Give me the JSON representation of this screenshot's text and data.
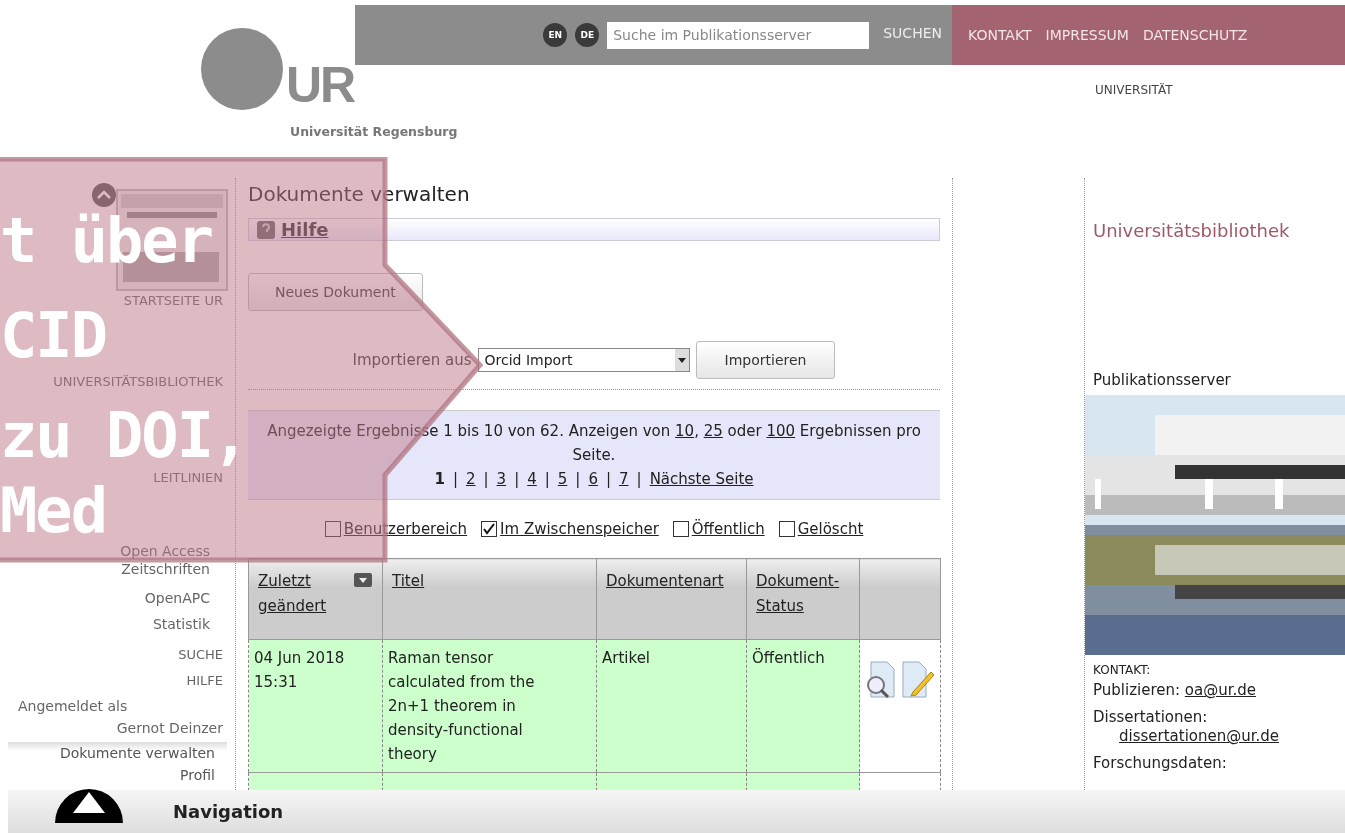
{
  "header": {
    "logo_text": "UR",
    "logo_caption": "Universität Regensburg",
    "languages": [
      {
        "label": "EN",
        "selected": false
      },
      {
        "label": "DE",
        "selected": false
      }
    ],
    "search": {
      "placeholder": "Suche im Publikationsserver"
    },
    "search_button": "SUCHEN",
    "top_links": [
      "KONTAKT",
      "IMPRESSUM",
      "DATENSCHUTZ"
    ],
    "university_label": "UNIVERSITÄT"
  },
  "sidebar": {
    "items": [
      {
        "label": "STARTSEITE UR",
        "kind": "main"
      },
      {
        "label": "UNIVERSITÄTSBIBLIOTHEK",
        "kind": "main"
      },
      {
        "label": "LEITLINIEN",
        "kind": "main"
      },
      {
        "label": "Open Access Zeitschriften",
        "kind": "sub"
      },
      {
        "label": "OpenAPC",
        "kind": "sub"
      },
      {
        "label": "Statistik",
        "kind": "sub"
      },
      {
        "label": "SUCHE",
        "kind": "main"
      },
      {
        "label": "HILFE",
        "kind": "main"
      }
    ],
    "login_label": "Angemeldet als",
    "user_name": "Gernot Deinzer",
    "user_menu": [
      {
        "label": "Dokumente verwalten",
        "selected": true
      },
      {
        "label": "Profil",
        "selected": false
      }
    ]
  },
  "main": {
    "title": "Dokumente verwalten",
    "help": "Hilfe",
    "new_button": "Neues Dokument",
    "import_label": "Importieren aus",
    "import_select": "Orcid Import",
    "import_button": "Importieren",
    "results": [
      {
        "text": "Angezeigte Ergebnisse 1 bis 10 von 62. Anzeigen von ",
        "kind": "text"
      },
      {
        "text": "10",
        "kind": "link"
      },
      {
        "text": ", ",
        "kind": "text"
      },
      {
        "text": "25",
        "kind": "link"
      },
      {
        "text": " oder ",
        "kind": "text"
      },
      {
        "text": "100",
        "kind": "link"
      },
      {
        "text": " Ergebnissen pro Seite.",
        "kind": "text"
      }
    ],
    "pages": [
      {
        "label": "1",
        "selected": true
      },
      {
        "label": "2",
        "selected": false
      },
      {
        "label": "3",
        "selected": false
      },
      {
        "label": "4",
        "selected": false
      },
      {
        "label": "5",
        "selected": false
      },
      {
        "label": "6",
        "selected": false
      },
      {
        "label": "7",
        "selected": false
      }
    ],
    "page_separator": "|",
    "next_page": "Nächste Seite",
    "filters": [
      {
        "label": "Benutzerbereich",
        "checked": false
      },
      {
        "label": "Im Zwischenspeicher",
        "checked": true
      },
      {
        "label": "Öffentlich",
        "checked": false
      },
      {
        "label": "Gelöscht",
        "checked": false
      }
    ],
    "table": {
      "columns": [
        "Zuletzt geändert",
        "Titel",
        "Dokumentenart",
        "Dokument-Status"
      ],
      "rows": [
        {
          "cells": [
            "04 Jun 2018 15:31",
            "Raman tensor calculated from the 2n+1 theorem in density-functional theory",
            "Artikel",
            "Öffentlich"
          ]
        }
      ]
    }
  },
  "right": {
    "heading": "Universitätsbibliothek",
    "image_title": "Publikationsserver",
    "contact_label": "KONTAKT:",
    "contacts": [
      {
        "label": "Publizieren:",
        "email": "oa@ur.de"
      },
      {
        "label": "Dissertationen:",
        "email": "dissertationen@ur.de"
      },
      {
        "label": "Forschungsdaten:"
      }
    ]
  },
  "overlay": {
    "lines": [
      "t über",
      "CID",
      "zu DOI,",
      "Med"
    ]
  },
  "bottom_bar": {
    "label": "Navigation"
  }
}
